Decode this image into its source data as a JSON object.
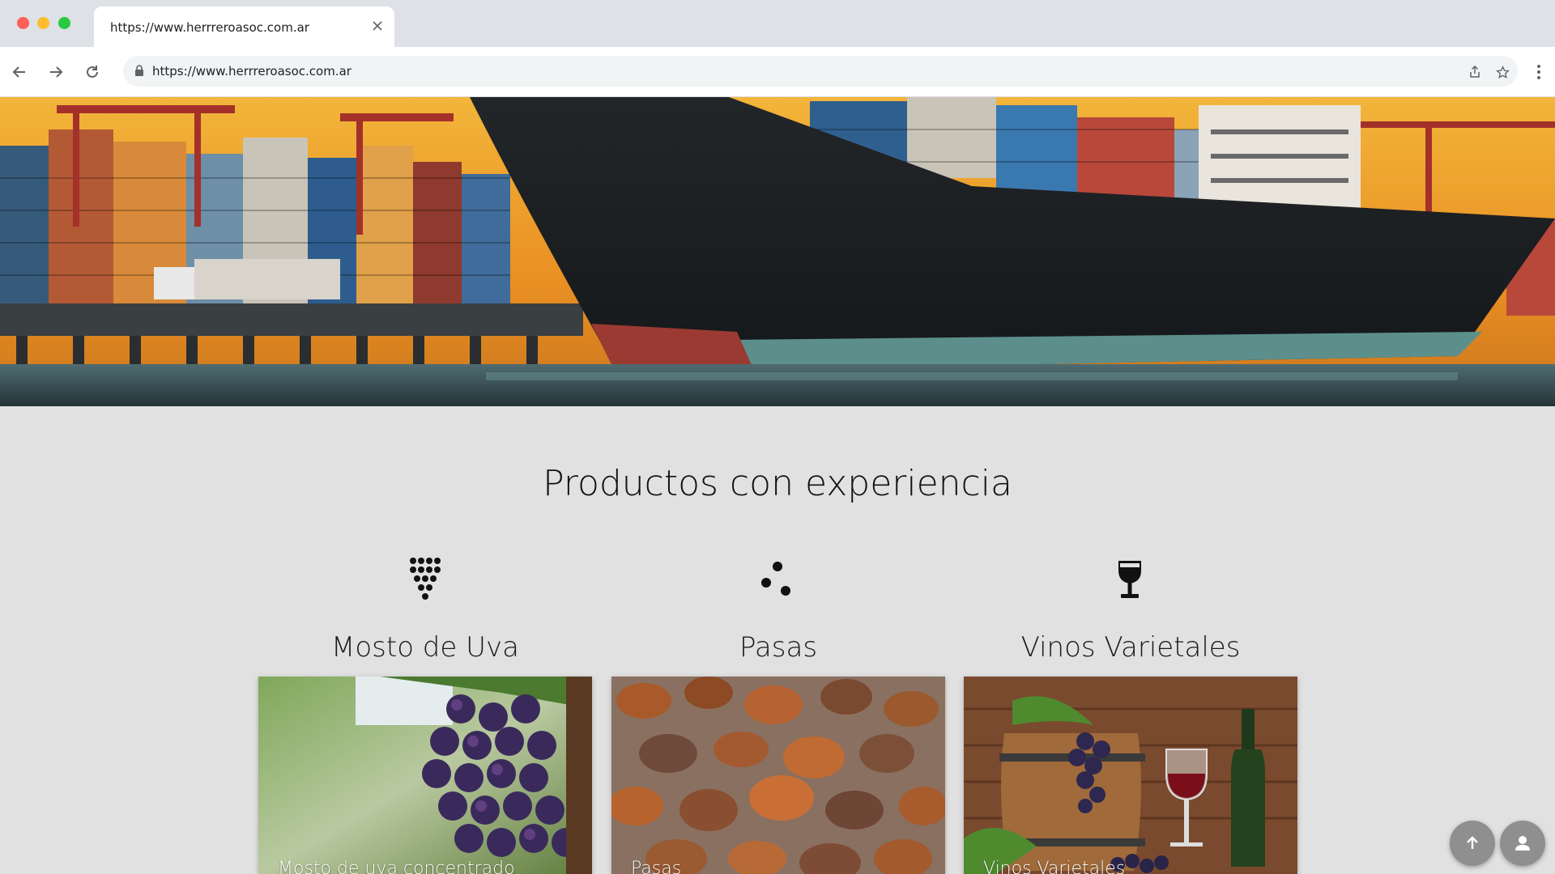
{
  "browser": {
    "tab_title": "https://www.herrreroasoc.com.ar",
    "url": "https://www.herrreroasoc.com.ar"
  },
  "hero": {
    "image": "container-ship-port-sunset"
  },
  "section": {
    "title": "Productos con experiencia"
  },
  "products": [
    {
      "name": "Mosto de Uva",
      "icon": "grape-cluster-icon",
      "image": "purple-grapes-vineyard",
      "caption": "Mosto de uva concentrado"
    },
    {
      "name": "Pasas",
      "icon": "raisins-dots-icon",
      "image": "raisins-closeup",
      "caption": "Pasas"
    },
    {
      "name": "Vinos Varietales",
      "icon": "wine-glass-icon",
      "image": "wine-barrel-bottle-glass",
      "caption": "Vinos Varietales"
    }
  ],
  "fabs": [
    {
      "icon": "arrow-up-icon"
    },
    {
      "icon": "user-icon"
    }
  ],
  "colors": {
    "page_bg": "#e1e1e1",
    "fab_bg": "#8f8f8f"
  }
}
